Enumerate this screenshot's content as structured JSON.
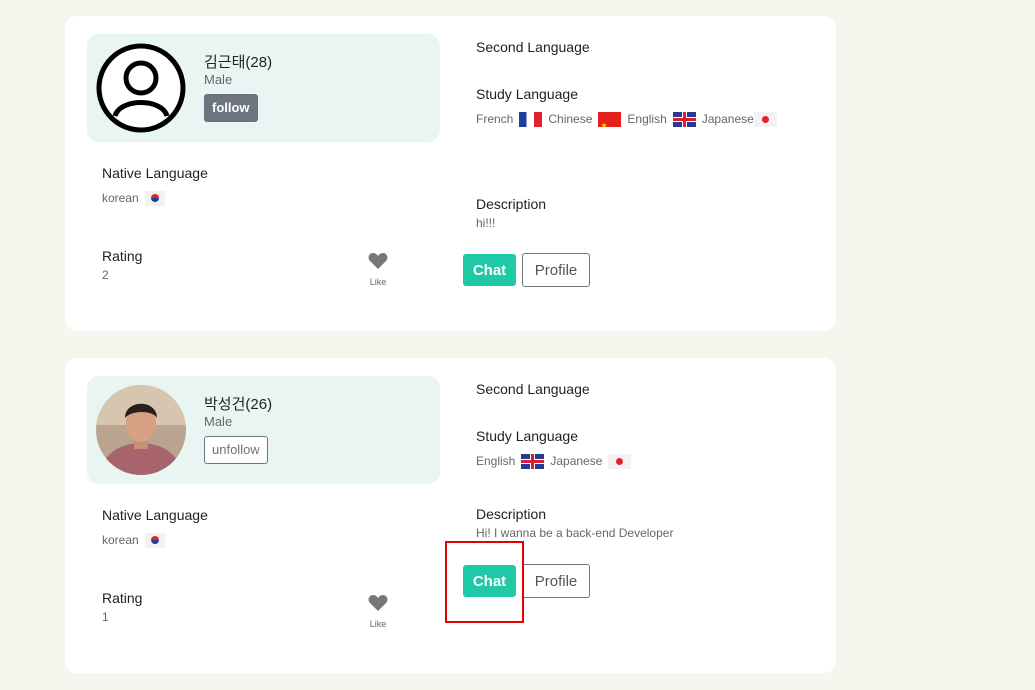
{
  "cards": [
    {
      "name": "김근태(28)",
      "gender": "Male",
      "follow_label": "follow",
      "native_language_label": "Native Language",
      "native_language": "korean",
      "rating_label": "Rating",
      "rating": "2",
      "like_label": "Like",
      "second_language_label": "Second Language",
      "study_language_label": "Study Language",
      "study_languages": [
        "French",
        "Chinese",
        "English",
        "Japanese"
      ],
      "description_label": "Description",
      "description": "hi!!!",
      "chat_label": "Chat",
      "profile_label": "Profile"
    },
    {
      "name": "박성건(26)",
      "gender": "Male",
      "follow_label": "unfollow",
      "native_language_label": "Native Language",
      "native_language": "korean",
      "rating_label": "Rating",
      "rating": "1",
      "like_label": "Like",
      "second_language_label": "Second Language",
      "study_language_label": "Study Language",
      "study_languages": [
        "English",
        "Japanese"
      ],
      "description_label": "Description",
      "description": "Hi! I wanna be a back-end Developer",
      "chat_label": "Chat",
      "profile_label": "Profile"
    }
  ],
  "colors": {
    "page_bg": "#f6f5ee",
    "accent": "#20c9a6",
    "profile_box_bg": "#e9f5f2",
    "highlight": "#e60000"
  },
  "icons": {
    "like": "heart-icon",
    "default_avatar": "user-circle-icon"
  }
}
